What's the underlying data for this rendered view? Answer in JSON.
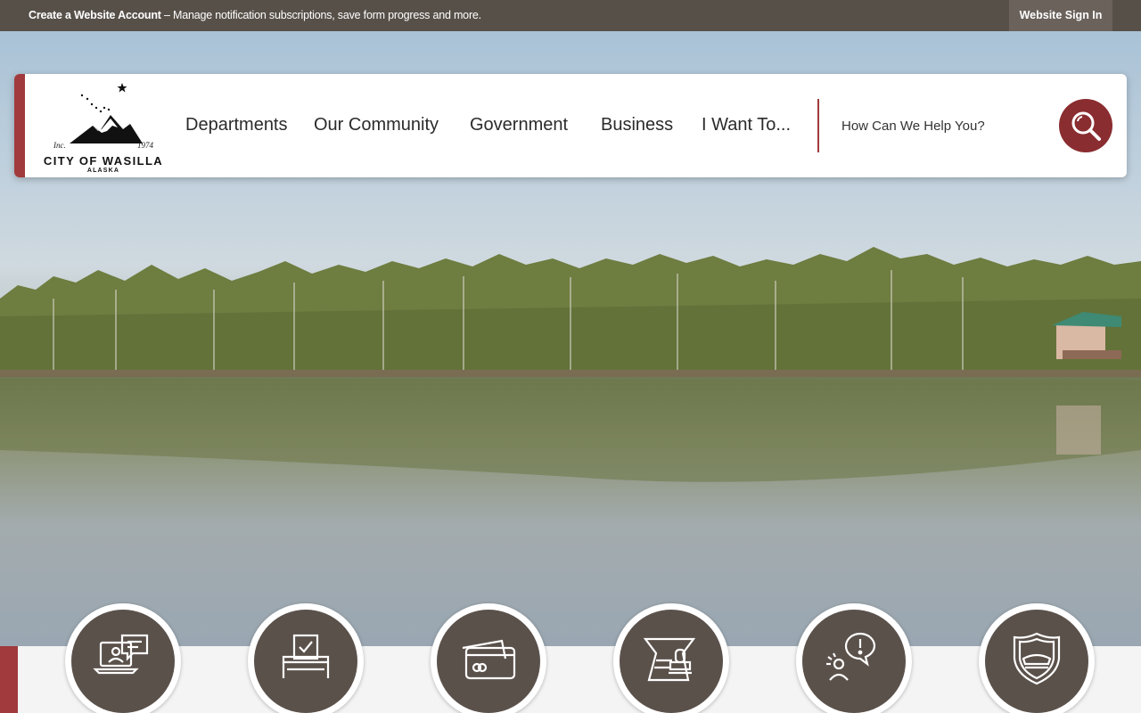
{
  "topbar": {
    "account_title": "Create a Website Account",
    "account_desc": " – Manage notification subscriptions, save form progress and more.",
    "signin_label": "Website Sign In"
  },
  "logo": {
    "name": "CITY OF WASILLA",
    "state": "ALASKA",
    "inc": "Inc.",
    "year": "1974"
  },
  "nav": [
    {
      "label": "Departments"
    },
    {
      "label": "Our Community"
    },
    {
      "label": "Government"
    },
    {
      "label": "Business"
    },
    {
      "label": "I Want To..."
    }
  ],
  "search": {
    "placeholder": "How Can We Help You?",
    "icon": "search-icon"
  },
  "quick_links": [
    {
      "icon": "online-services-icon"
    },
    {
      "icon": "voting-icon"
    },
    {
      "icon": "payment-card-icon"
    },
    {
      "icon": "permit-stamp-icon"
    },
    {
      "icon": "report-issue-icon"
    },
    {
      "icon": "police-badge-icon"
    }
  ],
  "colors": {
    "accent": "#a03a3c",
    "topbar": "#575049",
    "icon_circle": "#5b514b",
    "search_button": "#8a2d30"
  }
}
